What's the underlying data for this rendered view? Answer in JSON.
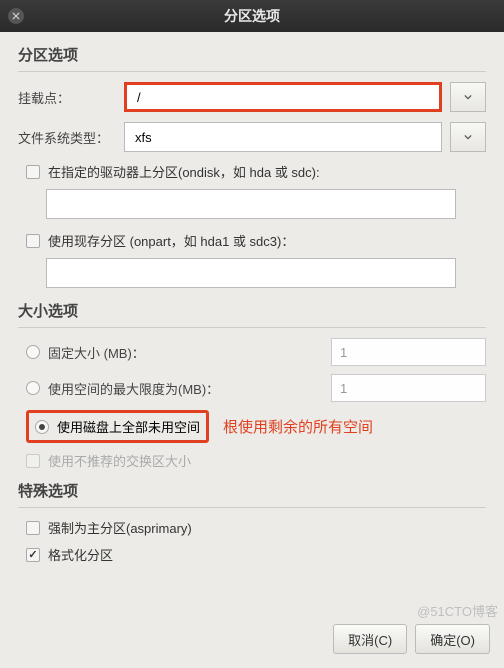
{
  "window": {
    "title": "分区选项"
  },
  "section_partition": {
    "title": "分区选项",
    "mount_label": "挂载点：",
    "mount_value": "/",
    "fs_label": "文件系统类型：",
    "fs_value": "xfs",
    "ondisk_label": "在指定的驱动器上分区(ondisk，如 hda 或 sdc):",
    "ondisk_value": "",
    "onpart_label": "使用现存分区 (onpart，如 hda1 或 sdc3)：",
    "onpart_value": ""
  },
  "section_size": {
    "title": "大小选项",
    "fixed_label": "固定大小 (MB)：",
    "fixed_value": "1",
    "maxsize_label": "使用空间的最大限度为(MB)：",
    "maxsize_value": "1",
    "useall_label": "使用磁盘上全部未用空间",
    "recommended_label": "使用不推荐的交换区大小",
    "annotation": "根使用剩余的所有空间"
  },
  "section_special": {
    "title": "特殊选项",
    "asprimary_label": "强制为主分区(asprimary)",
    "format_label": "格式化分区"
  },
  "buttons": {
    "cancel": "取消(C)",
    "ok": "确定(O)"
  },
  "watermark": "@51CTO博客"
}
